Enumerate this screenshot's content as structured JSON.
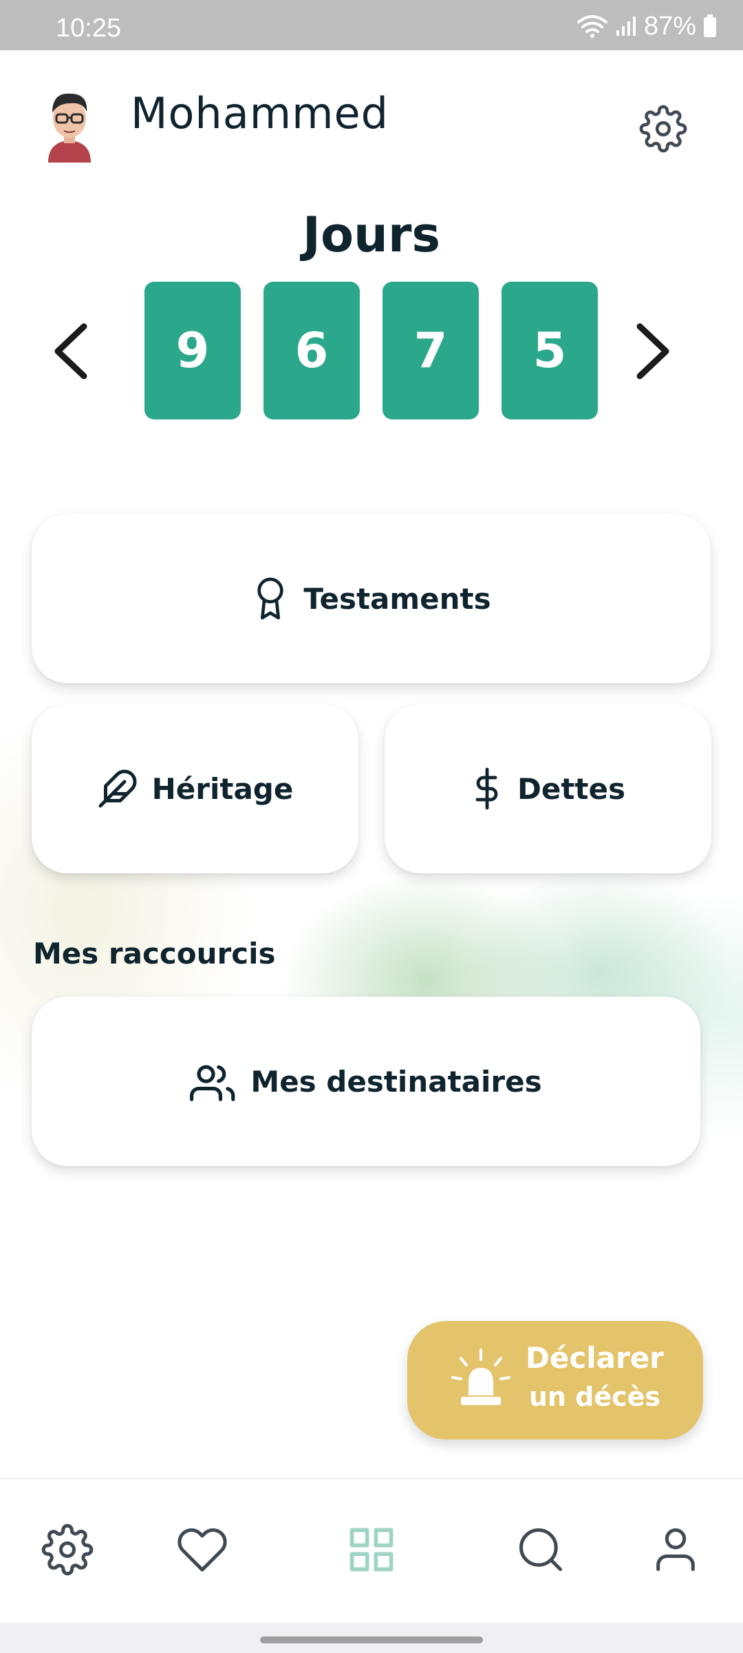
{
  "status_bar": {
    "time": "10:25",
    "battery": "87%"
  },
  "header": {
    "user_name": "Mohammed",
    "avatar_icon": "memoji-avatar",
    "settings_icon": "gear-icon"
  },
  "counter": {
    "title": "Jours",
    "digits": [
      "9",
      "6",
      "7",
      "5"
    ],
    "prev_icon": "chevron-left-icon",
    "next_icon": "chevron-right-icon",
    "digit_color": "#2ba88c"
  },
  "cards": {
    "testaments": "Testaments",
    "heritage": "Héritage",
    "dettes": "Dettes"
  },
  "shortcuts": {
    "title": "Mes raccourcis",
    "destinataires": "Mes destinataires"
  },
  "fab": {
    "line1": "Déclarer",
    "line2": "un décès",
    "icon": "siren-icon",
    "color": "#e3c46b"
  },
  "bottom_nav": {
    "items": [
      {
        "icon": "gear-icon"
      },
      {
        "icon": "heart-icon"
      },
      {
        "icon": "grid-icon",
        "active": true
      },
      {
        "icon": "search-icon"
      },
      {
        "icon": "user-icon"
      }
    ],
    "active_color": "#9fd4c4"
  }
}
